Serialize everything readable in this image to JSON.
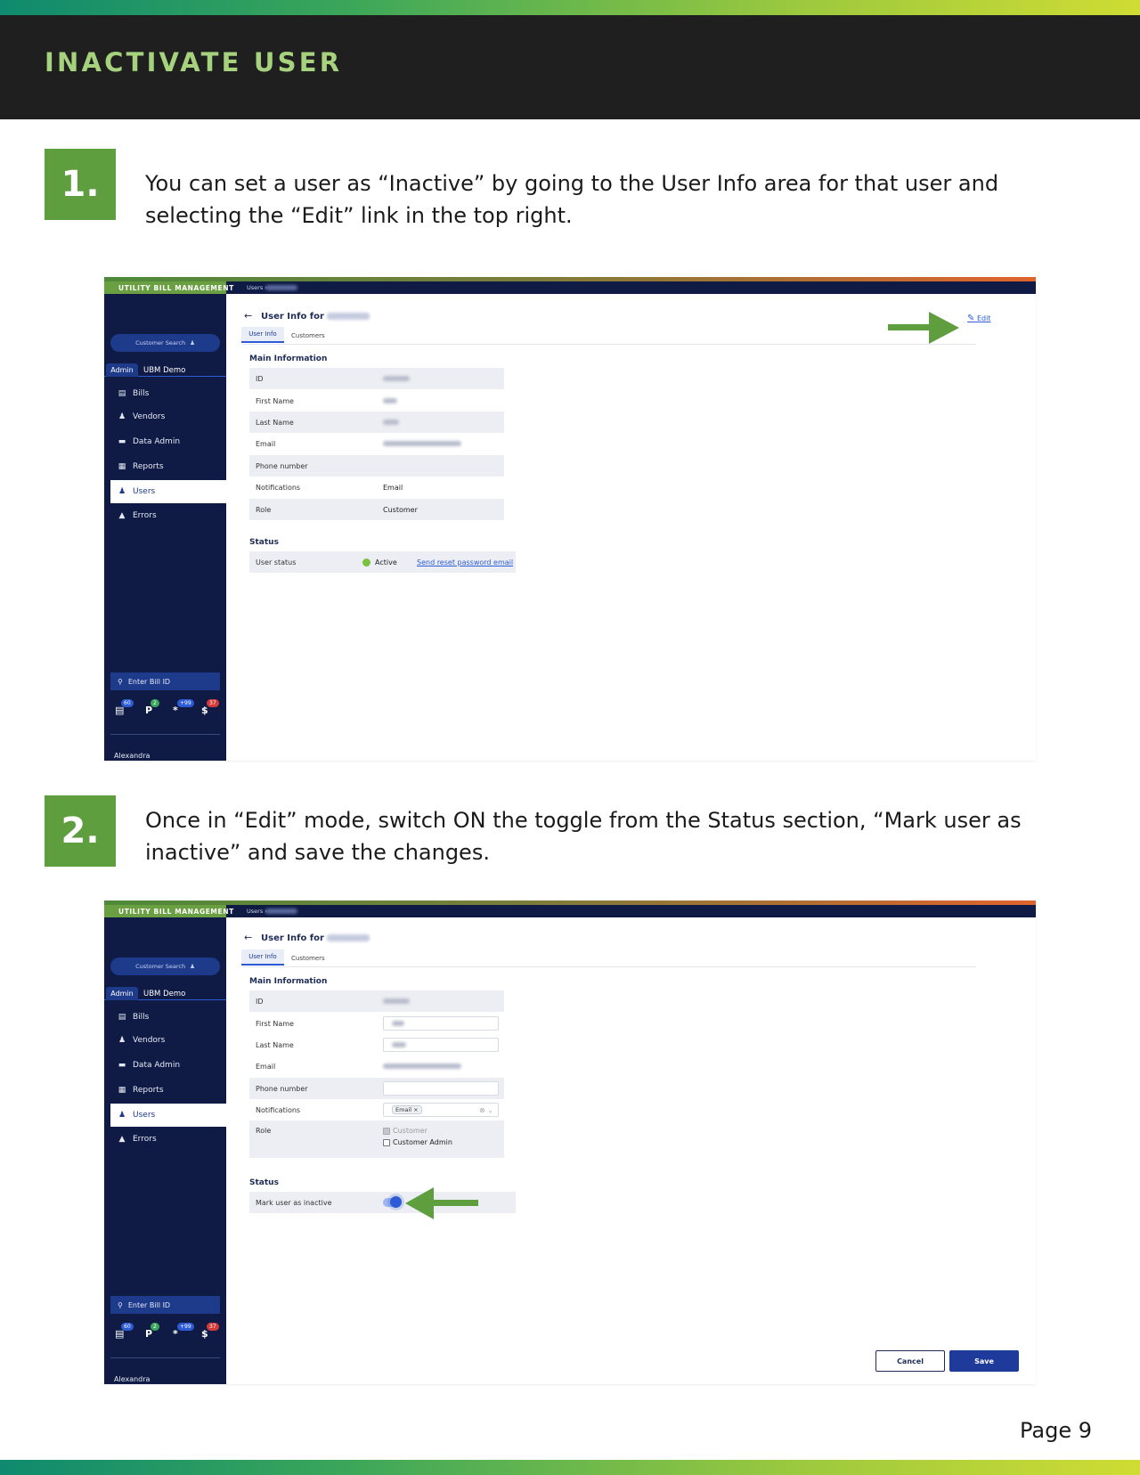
{
  "header": {
    "title": "INACTIVATE USER"
  },
  "steps": [
    {
      "number": "1.",
      "text": "You can set a user as “Inactive” by going to the User Info area for that user and selecting the “Edit” link in the top right."
    },
    {
      "number": "2.",
      "text": "Once in “Edit” mode, switch ON the toggle from the Status section, “Mark user as inactive” and save the changes."
    }
  ],
  "app": {
    "brand": "UTILITY BILL MANAGEMENT",
    "breadcrumb": "Users ›",
    "customer_search": "Customer Search",
    "sidebar_tabs": [
      "Admin",
      "UBM Demo"
    ],
    "nav": [
      "Bills",
      "Vendors",
      "Data Admin",
      "Reports",
      "Users",
      "Errors"
    ],
    "bill_search_placeholder": "Enter Bill ID",
    "badges": [
      {
        "icon": "bill-icon",
        "glyph": "🗏",
        "count": "60",
        "color": "#2d5bd6"
      },
      {
        "icon": "p-icon",
        "glyph": "P",
        "count": "2",
        "color": "#3aa65a"
      },
      {
        "icon": "asterisk-icon",
        "glyph": "*",
        "count": "+99",
        "color": "#2d5bd6"
      },
      {
        "icon": "dollar-icon",
        "glyph": "$",
        "count": "37",
        "color": "#d33b3b"
      }
    ],
    "user_name": "Alexandra",
    "page_title": "User Info for",
    "tab_user_info": "User Info",
    "tab_customers": "Customers",
    "edit_link": "Edit",
    "main_information": "Main Information",
    "status_section": "Status"
  },
  "shot1": {
    "fields": [
      {
        "label": "ID",
        "value": ""
      },
      {
        "label": "First Name",
        "value": ""
      },
      {
        "label": "Last Name",
        "value": ""
      },
      {
        "label": "Email",
        "value": ""
      },
      {
        "label": "Phone number",
        "value": ""
      },
      {
        "label": "Notifications",
        "value": "Email"
      },
      {
        "label": "Role",
        "value": "Customer"
      }
    ],
    "status_label": "User status",
    "status_value": "Active",
    "reset_link": "Send reset password email"
  },
  "shot2": {
    "fields": [
      {
        "label": "ID"
      },
      {
        "label": "First Name"
      },
      {
        "label": "Last Name"
      },
      {
        "label": "Email"
      },
      {
        "label": "Phone number"
      },
      {
        "label": "Notifications",
        "chip": "Email"
      },
      {
        "label": "Role",
        "options": [
          {
            "label": "Customer",
            "checked": true
          },
          {
            "label": "Customer Admin",
            "checked": false
          }
        ]
      }
    ],
    "toggle_label": "Mark user as inactive",
    "toggle_on": true,
    "cancel_label": "Cancel",
    "save_label": "Save"
  },
  "colors": {
    "accent_green": "#5f9e3f",
    "header_text": "#a6d27d",
    "nav_bg": "#0f1b45",
    "primary_blue": "#1e3a8a",
    "arrow_green": "#5f9e3f"
  },
  "footer": {
    "page": "Page 9"
  }
}
